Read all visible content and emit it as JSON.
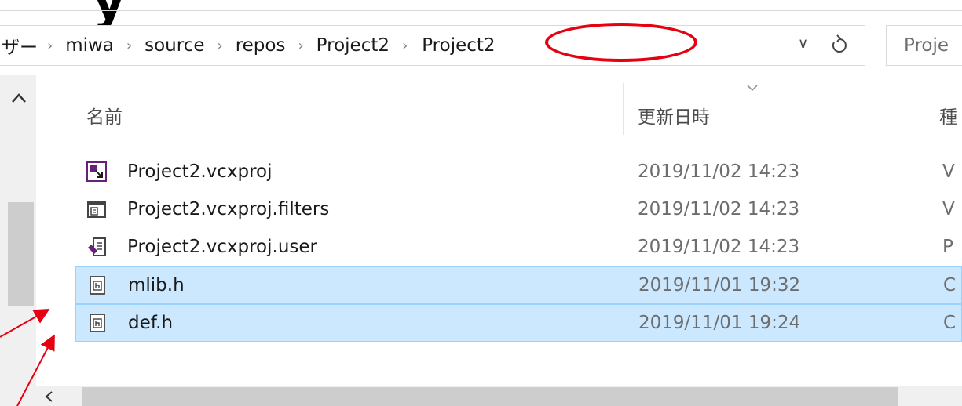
{
  "heading_glyph": "y",
  "breadcrumb": {
    "items": [
      "ザー",
      "miwa",
      "source",
      "repos",
      "Project2",
      "Project2"
    ],
    "separator": "›"
  },
  "address_bar": {
    "dropdown_glyph": "∨",
    "refresh_icon": "refresh-icon"
  },
  "search": {
    "placeholder": "Proje"
  },
  "columns": {
    "name": "名前",
    "date": "更新日時",
    "type": "種"
  },
  "files": [
    {
      "name": "Project2.vcxproj",
      "date": "2019/11/02 14:23",
      "type": "V",
      "icon": "vcxproj-icon",
      "selected": false
    },
    {
      "name": "Project2.vcxproj.filters",
      "date": "2019/11/02 14:23",
      "type": "V",
      "icon": "filters-icon",
      "selected": false
    },
    {
      "name": "Project2.vcxproj.user",
      "date": "2019/11/02 14:23",
      "type": "P",
      "icon": "vs-user-icon",
      "selected": false
    },
    {
      "name": "mlib.h",
      "date": "2019/11/01 19:32",
      "type": "C",
      "icon": "header-file-icon",
      "selected": true
    },
    {
      "name": "def.h",
      "date": "2019/11/01 19:24",
      "type": "C",
      "icon": "header-file-icon",
      "selected": true
    }
  ],
  "colors": {
    "selection_bg": "#cce8ff",
    "selection_border": "#99d1ff",
    "annotation_red": "#e60012"
  }
}
